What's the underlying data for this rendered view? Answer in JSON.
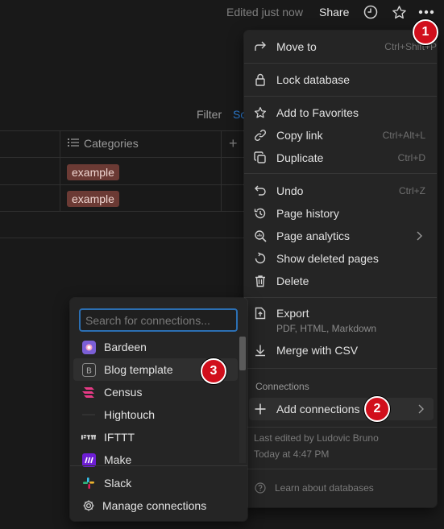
{
  "topbar": {
    "edited": "Edited just now",
    "share": "Share",
    "icons": [
      "clock-icon",
      "star-icon",
      "more-icon"
    ]
  },
  "table": {
    "filter": "Filter",
    "sort": "So",
    "column_header": "Categories",
    "add_column": "+",
    "rows": [
      {
        "tag": "example"
      },
      {
        "tag": "example"
      }
    ]
  },
  "menu": {
    "move_to": {
      "label": "Move to",
      "shortcut": "Ctrl+Shift+P"
    },
    "lock": {
      "label": "Lock database"
    },
    "favorites": {
      "label": "Add to Favorites"
    },
    "copy_link": {
      "label": "Copy link",
      "shortcut": "Ctrl+Alt+L"
    },
    "duplicate": {
      "label": "Duplicate",
      "shortcut": "Ctrl+D"
    },
    "undo": {
      "label": "Undo",
      "shortcut": "Ctrl+Z"
    },
    "page_history": {
      "label": "Page history"
    },
    "page_analytics": {
      "label": "Page analytics"
    },
    "show_deleted": {
      "label": "Show deleted pages"
    },
    "delete": {
      "label": "Delete"
    },
    "export": {
      "label": "Export",
      "sub": "PDF, HTML, Markdown"
    },
    "merge": {
      "label": "Merge with CSV"
    },
    "connections_section": "Connections",
    "add_connections": {
      "label": "Add connections"
    },
    "last_edited": "Last edited by Ludovic Bruno",
    "last_edited_time": "Today at 4:47 PM",
    "learn": "Learn about databases"
  },
  "connections": {
    "search_placeholder": "Search for connections...",
    "items": [
      {
        "label": "Bardeen",
        "icon": "bardeen-icon"
      },
      {
        "label": "Blog template",
        "icon": "blog-template-icon"
      },
      {
        "label": "Census",
        "icon": "census-icon"
      },
      {
        "label": "Hightouch",
        "icon": "hightouch-icon"
      },
      {
        "label": "IFTTT",
        "icon": "ifttt-icon"
      },
      {
        "label": "Make",
        "icon": "make-icon"
      }
    ],
    "slack": "Slack",
    "manage": "Manage connections"
  },
  "markers": [
    "1",
    "2",
    "3"
  ],
  "colors": {
    "background": "#191919",
    "menu": "#252525",
    "tag": "#6b3a34",
    "accent": "#2b6fb3",
    "marker": "#d10f1c"
  }
}
